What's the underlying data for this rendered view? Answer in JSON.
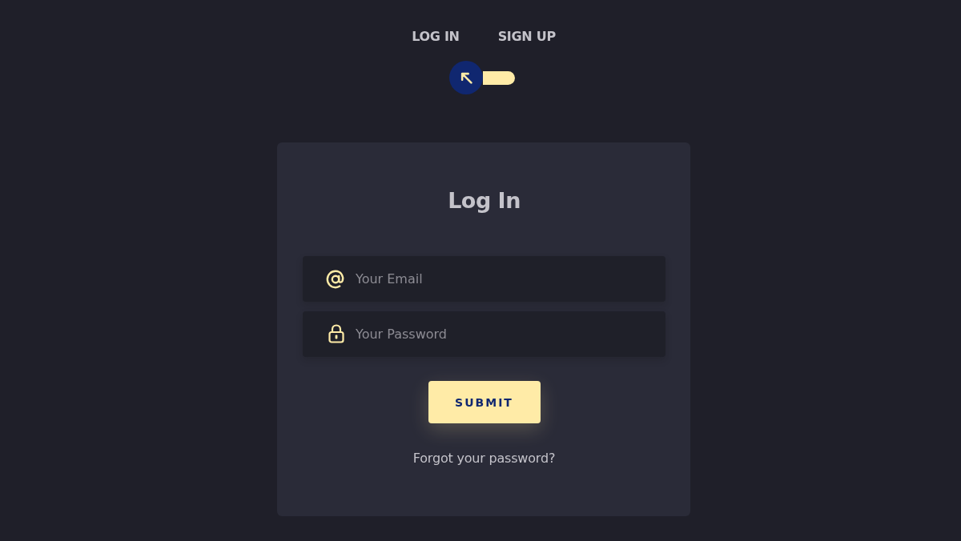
{
  "switch": {
    "labels": [
      "LOG IN",
      "SIGN UP"
    ],
    "on": false
  },
  "card": {
    "title": "Log In",
    "fields": [
      {
        "kind": "email",
        "placeholder": "Your Email"
      },
      {
        "kind": "password",
        "placeholder": "Your Password"
      }
    ],
    "submit": "SUBMIT",
    "link": "Forgot your password?"
  }
}
